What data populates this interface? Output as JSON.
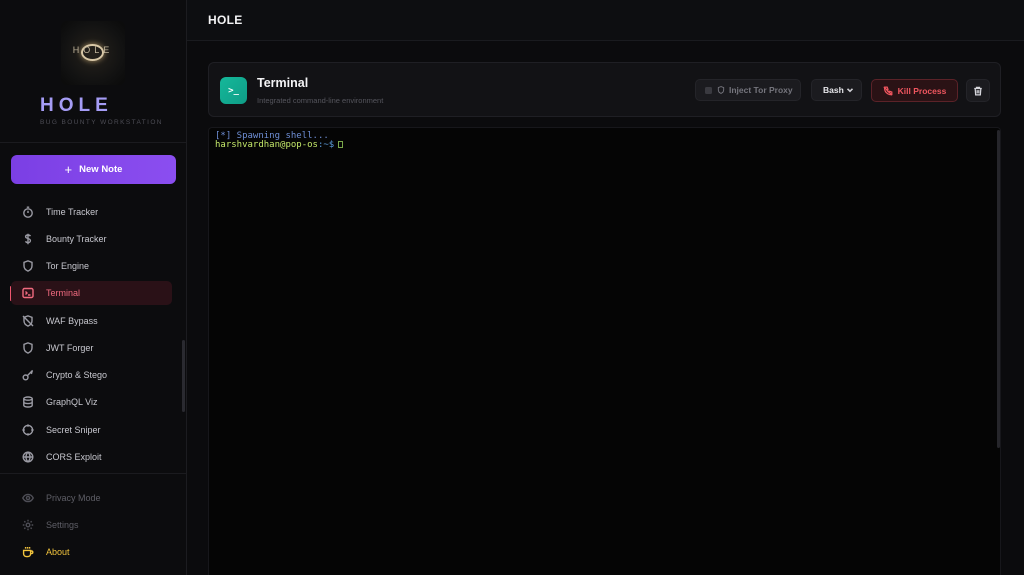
{
  "app": {
    "name": "HOLE",
    "tagline": "BUG BOUNTY WORKSTATION",
    "logo_text": "HOLE"
  },
  "sidebar": {
    "new_note_label": "New Note",
    "items": [
      {
        "label": "Time Tracker",
        "icon": "stopwatch-icon"
      },
      {
        "label": "Bounty Tracker",
        "icon": "dollar-icon"
      },
      {
        "label": "Tor Engine",
        "icon": "shield-icon"
      },
      {
        "label": "Terminal",
        "icon": "terminal-icon",
        "active": true
      },
      {
        "label": "WAF Bypass",
        "icon": "shield-off-icon"
      },
      {
        "label": "JWT Forger",
        "icon": "shield-icon"
      },
      {
        "label": "Crypto & Stego",
        "icon": "key-icon"
      },
      {
        "label": "GraphQL Viz",
        "icon": "database-icon"
      },
      {
        "label": "Secret Sniper",
        "icon": "crosshair-icon"
      },
      {
        "label": "CORS Exploit",
        "icon": "globe-icon"
      }
    ],
    "footer": [
      {
        "label": "Privacy Mode",
        "icon": "eye-icon"
      },
      {
        "label": "Settings",
        "icon": "gear-icon"
      },
      {
        "label": "About",
        "icon": "coffee-icon"
      }
    ]
  },
  "header": {
    "title": "HOLE"
  },
  "panel": {
    "title": "Terminal",
    "subtitle": "Integrated command-line environment",
    "tor_label": "Inject Tor Proxy",
    "shell_value": "Bash",
    "kill_label": "Kill Process"
  },
  "terminal": {
    "line1": "[*] Spawning shell...",
    "user_host": "harshvardhan@pop-os",
    "path": ":~",
    "prompt": "$"
  },
  "colors": {
    "accent": "#8b4ef0",
    "brand": "#a59cf5",
    "active": "#f06a7f",
    "danger": "#f0565f",
    "about": "#f2c43d",
    "terminal_icon": "#15b89a"
  }
}
